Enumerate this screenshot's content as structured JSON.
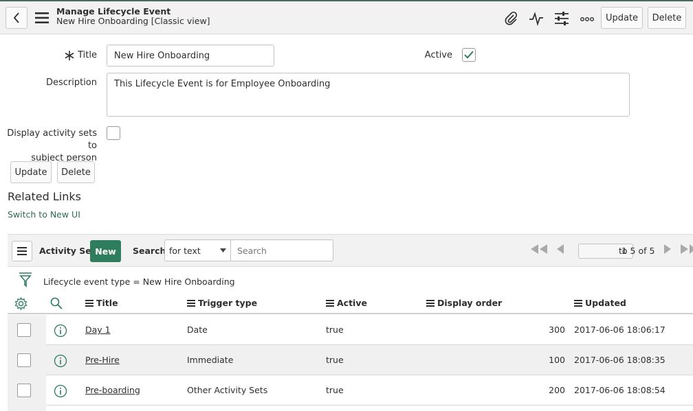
{
  "header": {
    "title": "Manage Lifecycle Event",
    "subtitle": "New Hire Onboarding [Classic view]",
    "update_label": "Update",
    "delete_label": "Delete"
  },
  "form": {
    "title_label": "Title",
    "title_value": "New Hire Onboarding",
    "active_label": "Active",
    "active_checked": true,
    "description_label": "Description",
    "description_value": "This Lifecycle Event is for Employee Onboarding",
    "display_label_line1": "Display activity sets to",
    "display_label_line2": "subject person",
    "display_checked": false,
    "update_label": "Update",
    "delete_label": "Delete"
  },
  "related": {
    "title": "Related Links",
    "link": "Switch to New UI"
  },
  "list": {
    "name": "Activity Sets",
    "new_label": "New",
    "search_label": "Search",
    "search_field": "for text",
    "search_placeholder": "Search",
    "page_value": "1",
    "page_text": "to 5 of 5",
    "filter": "Lifecycle event type = New Hire Onboarding",
    "columns": [
      "Title",
      "Trigger type",
      "Active",
      "Display order",
      "Updated"
    ],
    "rows": [
      {
        "title": "Day 1",
        "trigger": "Date",
        "active": "true",
        "order": "300",
        "updated": "2017-06-06 18:06:17"
      },
      {
        "title": "Pre-Hire",
        "trigger": "Immediate",
        "active": "true",
        "order": "100",
        "updated": "2017-06-06 18:08:35"
      },
      {
        "title": "Pre-boarding",
        "trigger": "Other Activity Sets",
        "active": "true",
        "order": "200",
        "updated": "2017-06-06 18:08:54"
      }
    ]
  },
  "colors": {
    "accent": "#2e7d5f",
    "link": "#2d6a5a"
  }
}
